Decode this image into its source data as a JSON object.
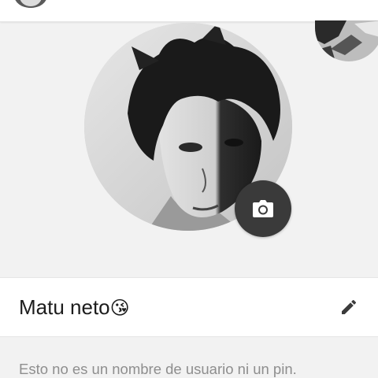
{
  "profile": {
    "name": "Matu neto",
    "name_emoji": "😘",
    "photo_icon": "profile-photo",
    "camera_icon": "camera-icon",
    "edit_icon": "pencil-icon",
    "hint": "Esto no es un nombre de usuario ni un pin."
  },
  "colors": {
    "background": "#f2f2f2",
    "card": "#ffffff",
    "camera_button": "#3a3a3a",
    "hint_text": "#8e8e8e"
  }
}
